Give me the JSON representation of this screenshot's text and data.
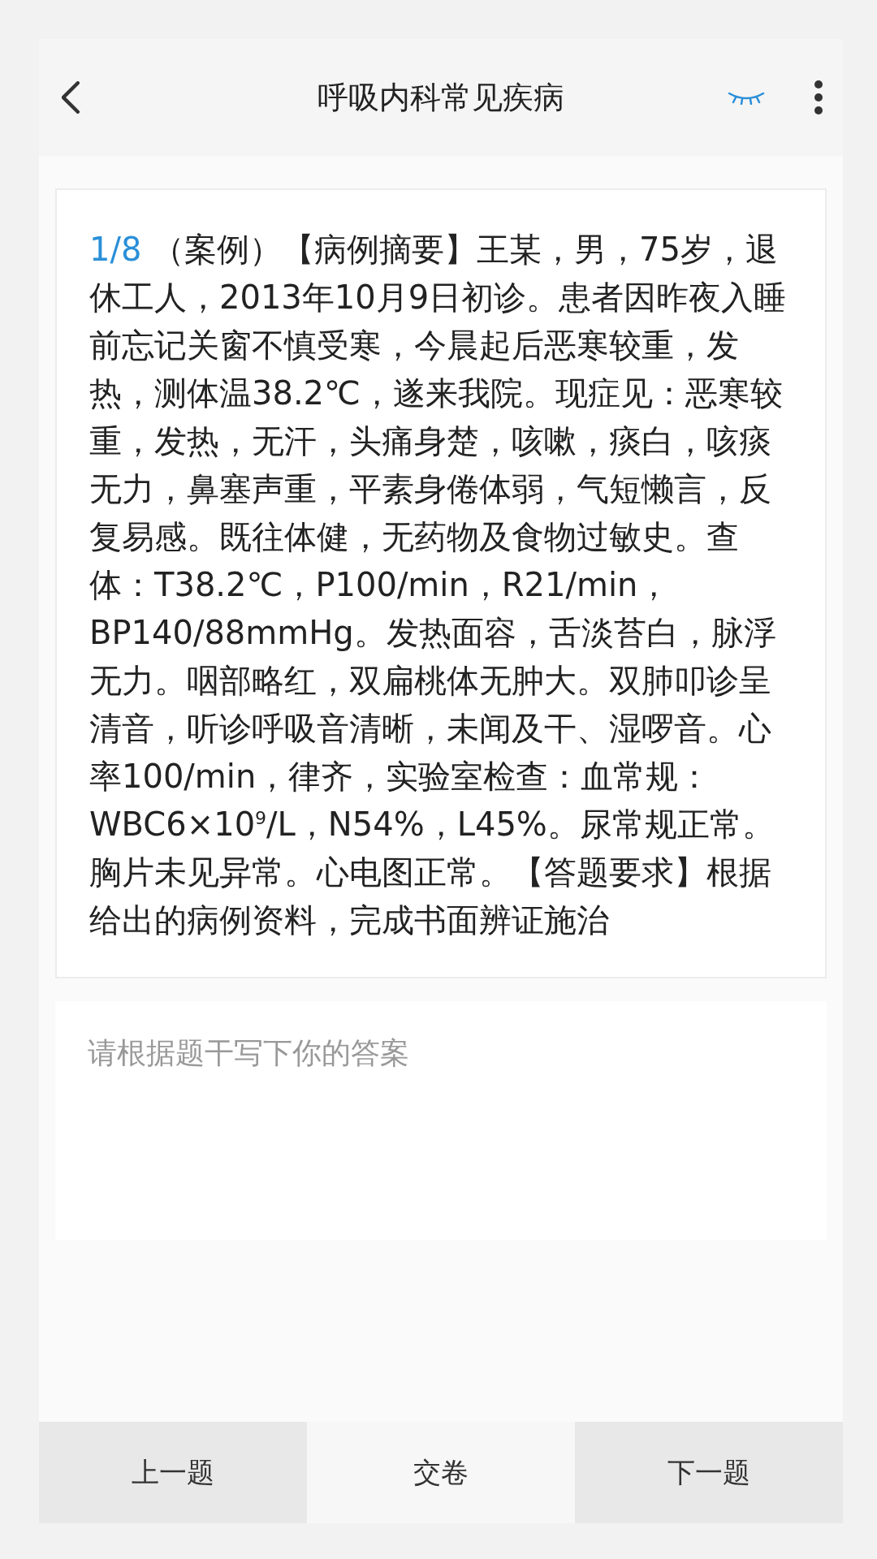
{
  "header": {
    "title": "呼吸内科常见疾病"
  },
  "question": {
    "number": "1/8",
    "text": "（案例）【病例摘要】王某，男，75岁，退休工人，2013年10月9日初诊。患者因昨夜入睡前忘记关窗不慎受寒，今晨起后恶寒较重，发热，测体温38.2℃，遂来我院。现症见：恶寒较重，发热，无汗，头痛身楚，咳嗽，痰白，咳痰无力，鼻塞声重，平素身倦体弱，气短懒言，反复易感。既往体健，无药物及食物过敏史。查体：T38.2℃，P100/min，R21/min，BP140/88mmHg。发热面容，舌淡苔白，脉浮无力。咽部略红，双扁桃体无肿大。双肺叩诊呈清音，听诊呼吸音清晰，未闻及干、湿啰音。心率100/min，律齐，实验室检查：血常规：WBC6×10$^{9}$/L，N54%，L45%。尿常规正常。胸片未见异常。心电图正常。【答题要求】根据给出的病例资料，完成书面辨证施治"
  },
  "answer": {
    "placeholder": "请根据题干写下你的答案"
  },
  "footer": [
    {
      "label": "上一题",
      "kind": "nav"
    },
    {
      "label": "交卷",
      "kind": "submit"
    },
    {
      "label": "下一题",
      "kind": "nav"
    }
  ]
}
